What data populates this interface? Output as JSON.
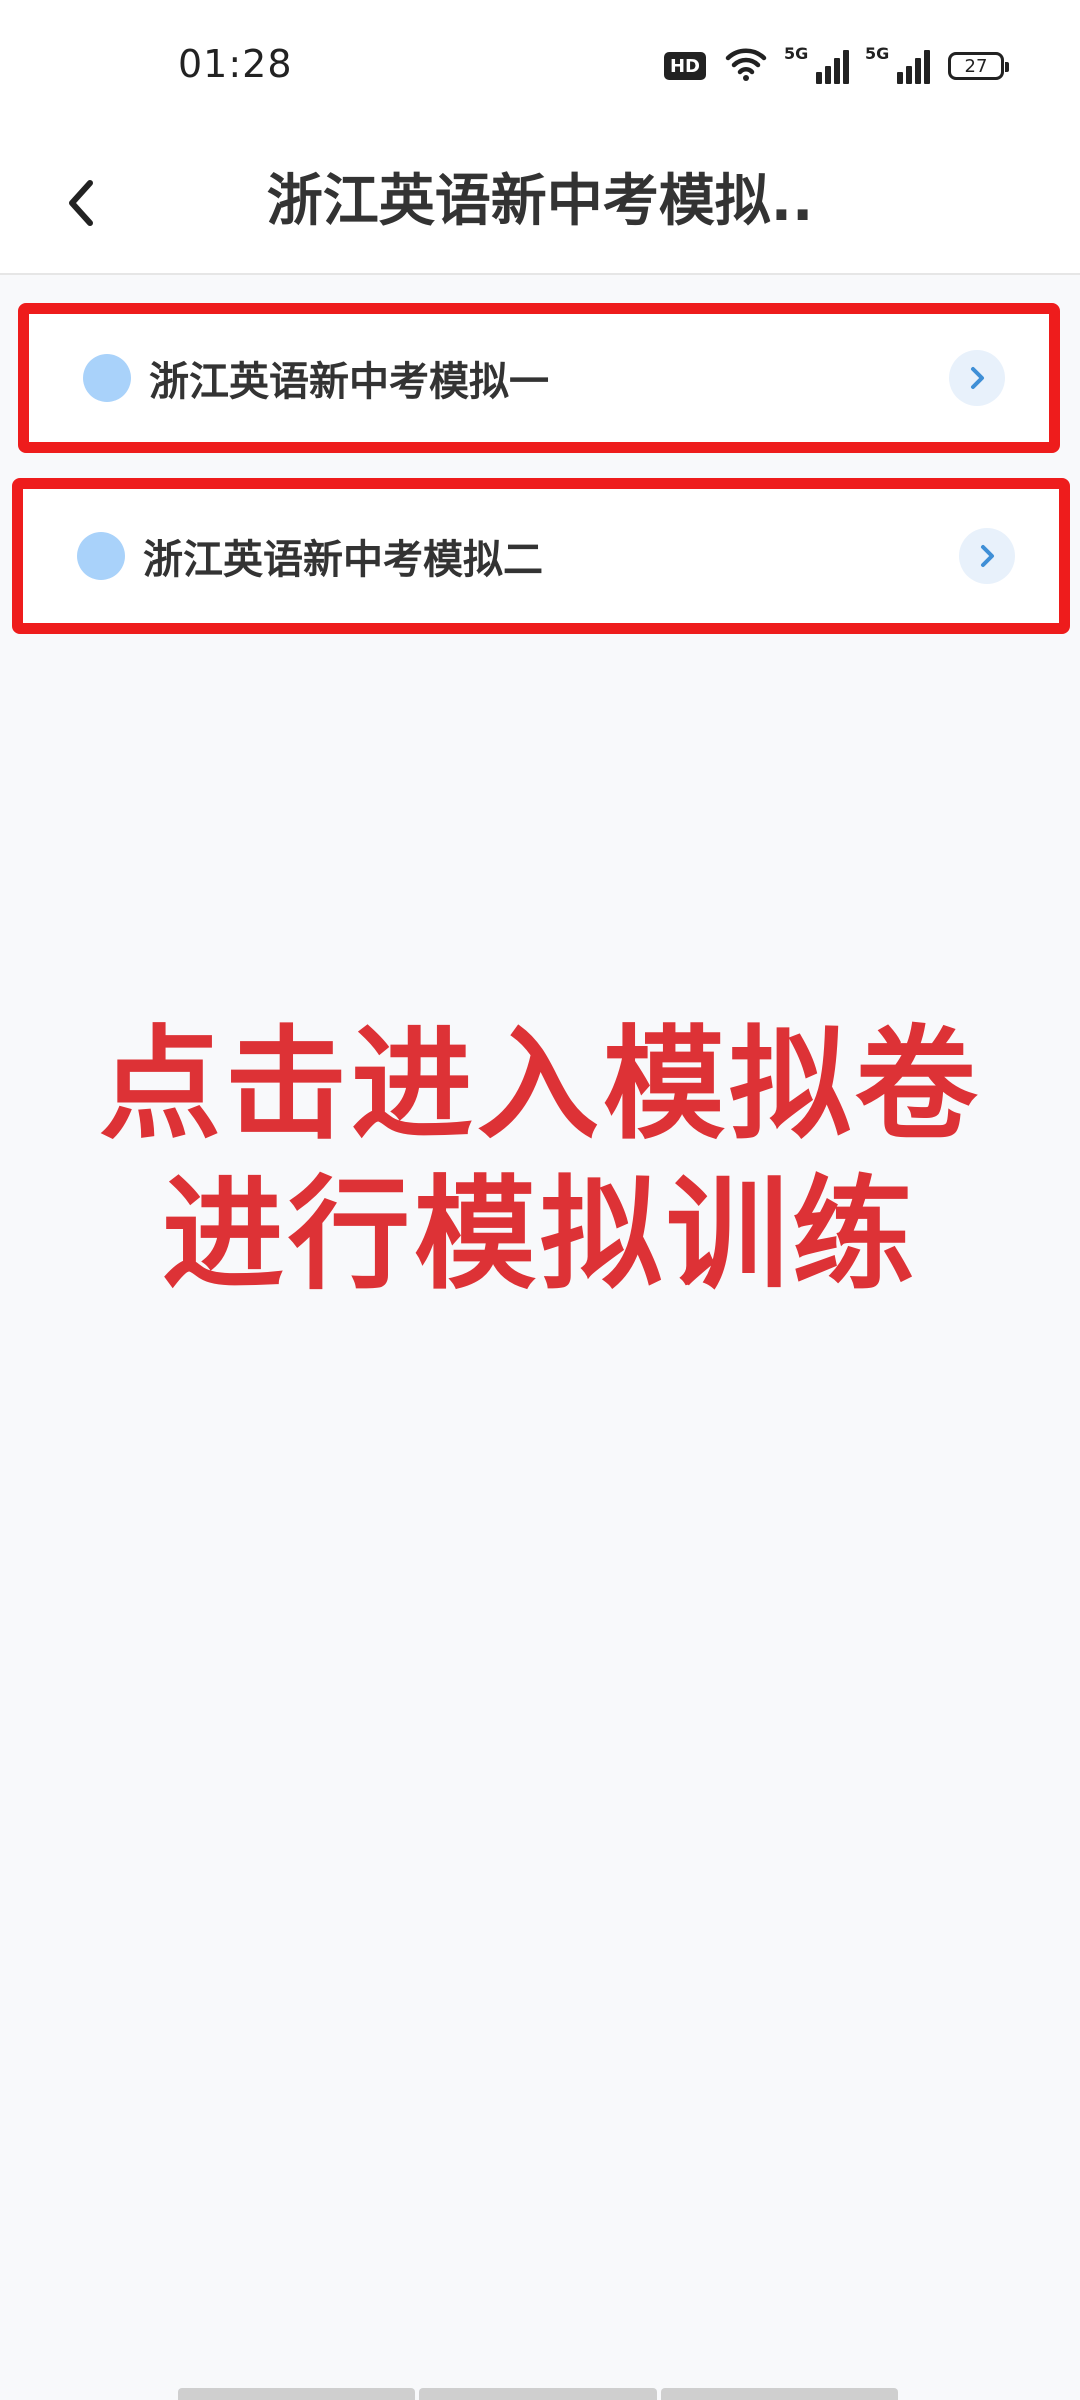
{
  "status_bar": {
    "time": "01:28",
    "hd_label": "HD",
    "network_1": "5G",
    "network_2": "5G",
    "battery": "27"
  },
  "header": {
    "back_icon": "chevron-left-icon",
    "title": "浙江英语新中考模拟.."
  },
  "exam_list": {
    "items": [
      {
        "label": "浙江英语新中考模拟一",
        "icon": "dot-icon",
        "arrow": "chevron-right-icon"
      },
      {
        "label": "浙江英语新中考模拟二",
        "icon": "dot-icon",
        "arrow": "chevron-right-icon"
      }
    ]
  },
  "caption": {
    "line1": "点击进入模拟卷",
    "line2": "进行模拟训练"
  },
  "colors": {
    "highlight_border": "#ee1c1c",
    "caption_text": "#dd3236",
    "dot": "#a9d2fa",
    "arrow_bg": "#e8f1fb",
    "arrow_fg": "#3f8fd6"
  }
}
